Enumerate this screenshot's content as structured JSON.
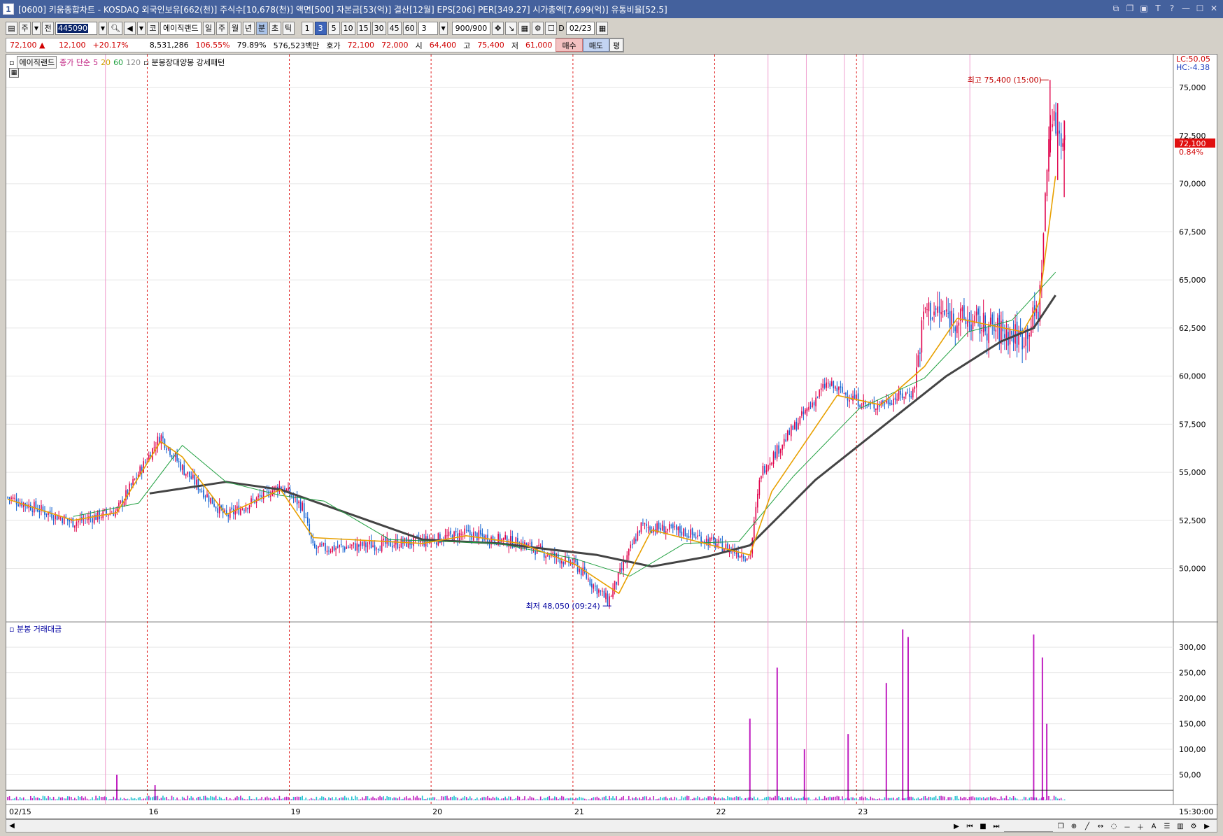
{
  "window": {
    "number": "1",
    "title": "[0600] 키움종합차트 - KOSDAQ 외국인보유[662(천)] 주식수[10,678(천)] 액면[500] 자본금[53(억)] 결산[12월] EPS[206] PER[349.27] 시가총액[7,699(억)] 유통비율[52.5]"
  },
  "toolbar1": {
    "market": "주",
    "period_type": "전",
    "code": "445090",
    "market_label": "코",
    "stock_name": "에이직랜드",
    "tabs": [
      "일",
      "주",
      "월",
      "년",
      "분",
      "초",
      "틱"
    ],
    "active_tab": "분",
    "intervals": [
      "1",
      "3",
      "5",
      "10",
      "15",
      "30",
      "45",
      "60"
    ],
    "active_interval": "3",
    "interval_value": "3",
    "count": "900/900",
    "date_label": "D",
    "date_value": "02/23"
  },
  "toolbar2": {
    "price": "72,100",
    "change": "12,100",
    "change_pct": "+20.17%",
    "volume": "8,531,286",
    "vol_ratio": "106.55%",
    "turnover": "79.89%",
    "amount": "576,523백만",
    "ask_label": "호가",
    "ask": "72,100",
    "bid": "72,000",
    "open_label": "시",
    "open": "64,400",
    "high_label": "고",
    "high": "75,400",
    "low_label": "저",
    "low": "61,000",
    "buy_label": "매수",
    "sell_label": "매도",
    "avg_label": "평"
  },
  "price_legend": {
    "stock": "에이직랜드",
    "indicator": "종가 단순",
    "ma": [
      "5",
      "20",
      "60",
      "120"
    ],
    "pattern": "분봉장대양봉 강세패턴"
  },
  "volume_legend": "분봉 거래대금",
  "colors": {
    "up": "#e0004a",
    "down": "#1060d0",
    "ma5": "#e8a000",
    "ma20": "#20a040",
    "ma60": "#444444",
    "ma120": "#888888",
    "day_line": "#e02020",
    "pink_line": "#f0a0d0",
    "vol_up": "#c020c0",
    "vol_down": "#20c0d0"
  },
  "chart_data": {
    "type": "candlestick",
    "price_axis": {
      "ticks": [
        "75,000",
        "72,500",
        "70,000",
        "67,500",
        "65,000",
        "62,500",
        "60,000",
        "57,500",
        "55,000",
        "52,500",
        "50,000"
      ],
      "tick_values": [
        75000,
        72500,
        70000,
        67500,
        65000,
        62500,
        60000,
        57500,
        55000,
        52500,
        50000
      ],
      "ylim": [
        47400,
        76500
      ],
      "lc": "LC:50.05",
      "hc": "HC:-4.38",
      "current_price": "72,100",
      "current_pct": "0.84%"
    },
    "volume_axis": {
      "ticks": [
        "300,00",
        "250,00",
        "200,00",
        "150,00",
        "100,00",
        "50,00"
      ],
      "tick_values": [
        300,
        250,
        200,
        150,
        100,
        50
      ],
      "ylim": [
        0,
        340
      ]
    },
    "x_labels": [
      "02/15",
      "16",
      "19",
      "20",
      "21",
      "22",
      "23"
    ],
    "time_label": "15:30:00",
    "annotations": {
      "high": "최고 75,400 (15:00)",
      "low": "최저 48,050 (09:24)"
    },
    "key_points": [
      {
        "x": 0.0,
        "close": 53700
      },
      {
        "x": 0.06,
        "close": 52400
      },
      {
        "x": 0.1,
        "close": 53000
      },
      {
        "x": 0.14,
        "close": 56900
      },
      {
        "x": 0.16,
        "close": 55200
      },
      {
        "x": 0.2,
        "close": 52700
      },
      {
        "x": 0.25,
        "close": 54300
      },
      {
        "x": 0.27,
        "close": 53200
      },
      {
        "x": 0.28,
        "close": 51000
      },
      {
        "x": 0.38,
        "close": 51400
      },
      {
        "x": 0.42,
        "close": 51800
      },
      {
        "x": 0.47,
        "close": 51300
      },
      {
        "x": 0.52,
        "close": 50200
      },
      {
        "x": 0.55,
        "close": 48300
      },
      {
        "x": 0.58,
        "close": 52200
      },
      {
        "x": 0.62,
        "close": 51900
      },
      {
        "x": 0.68,
        "close": 50600
      },
      {
        "x": 0.69,
        "close": 55000
      },
      {
        "x": 0.75,
        "close": 59600
      },
      {
        "x": 0.79,
        "close": 58400
      },
      {
        "x": 0.83,
        "close": 59200
      },
      {
        "x": 0.84,
        "close": 63500
      },
      {
        "x": 0.9,
        "close": 62500
      },
      {
        "x": 0.93,
        "close": 62000
      },
      {
        "x": 0.945,
        "close": 63500
      },
      {
        "x": 0.955,
        "close": 73500
      },
      {
        "x": 0.97,
        "close": 72100
      }
    ],
    "ma5_path": [
      [
        0.0,
        53600
      ],
      [
        0.06,
        52500
      ],
      [
        0.1,
        52900
      ],
      [
        0.14,
        56600
      ],
      [
        0.16,
        55800
      ],
      [
        0.2,
        52800
      ],
      [
        0.25,
        54100
      ],
      [
        0.28,
        51600
      ],
      [
        0.38,
        51300
      ],
      [
        0.42,
        51700
      ],
      [
        0.47,
        51300
      ],
      [
        0.52,
        50200
      ],
      [
        0.56,
        48700
      ],
      [
        0.59,
        52000
      ],
      [
        0.68,
        50700
      ],
      [
        0.7,
        54000
      ],
      [
        0.76,
        59000
      ],
      [
        0.8,
        58500
      ],
      [
        0.84,
        60500
      ],
      [
        0.87,
        63000
      ],
      [
        0.93,
        62300
      ],
      [
        0.945,
        63800
      ],
      [
        0.96,
        70400
      ]
    ],
    "ma20_path": [
      [
        0.06,
        52700
      ],
      [
        0.12,
        53400
      ],
      [
        0.16,
        56400
      ],
      [
        0.2,
        54500
      ],
      [
        0.25,
        53800
      ],
      [
        0.29,
        53500
      ],
      [
        0.35,
        51500
      ],
      [
        0.45,
        51300
      ],
      [
        0.52,
        50500
      ],
      [
        0.57,
        49600
      ],
      [
        0.62,
        51300
      ],
      [
        0.67,
        51400
      ],
      [
        0.72,
        54800
      ],
      [
        0.78,
        58300
      ],
      [
        0.84,
        59900
      ],
      [
        0.88,
        62300
      ],
      [
        0.92,
        62900
      ],
      [
        0.96,
        65400
      ]
    ],
    "ma60_path": [
      [
        0.13,
        53900
      ],
      [
        0.2,
        54500
      ],
      [
        0.25,
        54100
      ],
      [
        0.3,
        53100
      ],
      [
        0.38,
        51500
      ],
      [
        0.45,
        51300
      ],
      [
        0.54,
        50700
      ],
      [
        0.59,
        50100
      ],
      [
        0.64,
        50600
      ],
      [
        0.68,
        51200
      ],
      [
        0.74,
        54600
      ],
      [
        0.8,
        57300
      ],
      [
        0.86,
        60000
      ],
      [
        0.91,
        61800
      ],
      [
        0.94,
        62500
      ],
      [
        0.96,
        64200
      ]
    ],
    "volume_spikes": [
      {
        "x": 0.1,
        "value": 50
      },
      {
        "x": 0.135,
        "value": 30
      },
      {
        "x": 0.68,
        "value": 160
      },
      {
        "x": 0.705,
        "value": 260
      },
      {
        "x": 0.73,
        "value": 100
      },
      {
        "x": 0.77,
        "value": 130
      },
      {
        "x": 0.805,
        "value": 230
      },
      {
        "x": 0.82,
        "value": 335
      },
      {
        "x": 0.825,
        "value": 320
      },
      {
        "x": 0.94,
        "value": 325
      },
      {
        "x": 0.948,
        "value": 280
      },
      {
        "x": 0.952,
        "value": 150
      }
    ]
  },
  "scrollbar": {
    "left_arrow": "◀",
    "right_icons": [
      "▶",
      "⏮",
      "■",
      "⏭"
    ]
  }
}
